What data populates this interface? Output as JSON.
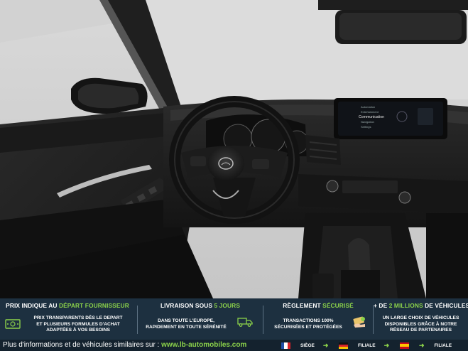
{
  "banner": {
    "col1": {
      "title_main": "PRIX INDIQUE AU ",
      "title_hl": "DÉPART FOURNISSEUR",
      "lines": [
        "PRIX TRANSPARENTS DÈS LE DEPART",
        "ET PLUSIEURS FORMULES D'ACHAT",
        "ADAPTÉES À VOS BESOINS"
      ],
      "icon": "money-icon"
    },
    "col2": {
      "title_main": "LIVRAISON SOUS ",
      "title_hl": "5 JOURS",
      "lines": [
        "DANS TOUTE L'EUROPE,",
        "RAPIDEMENT EN TOUTE SÉRÉNITÉ"
      ],
      "icon": "delivery-truck-icon"
    },
    "col3": {
      "title_main": "RÈGLEMENT ",
      "title_hl": "SÉCURISÉ",
      "lines": [
        "TRANSACTIONS 100%",
        "SÉCURISÉES ET PROTÉGÉES"
      ],
      "icon": "secure-payment-icon"
    },
    "col4": {
      "title_main": "+ DE ",
      "title_hl": "2 MILLIONS",
      "title_tail": " DE VÉHICULES",
      "lines": [
        "UN LARGE CHOIX DE VÉHICULES",
        "DISPONIBLES GRÂCE À NOTRE",
        "RÉSEAU DE PARTENAIRES"
      ],
      "icon": "car-network-icon"
    }
  },
  "footer": {
    "info_text": "Plus d'informations et de véhicules similaires sur : ",
    "link": "www.lb-automobiles.com",
    "langs": [
      {
        "label": "SIÈGE",
        "flag": "france-flag-icon"
      },
      {
        "label": "FILIALE",
        "flag": "germany-flag-icon"
      },
      {
        "label": "FILIALE",
        "flag": "spain-flag-icon"
      }
    ]
  },
  "screen": {
    "menu": [
      "Automation",
      "Entertainment",
      "Communication",
      "Navigation",
      "Settings"
    ],
    "selected": "Communication"
  },
  "colors": {
    "banner_bg": "#1d3040",
    "accent_green": "#8bd14a",
    "footer_bg": "#14222e"
  }
}
